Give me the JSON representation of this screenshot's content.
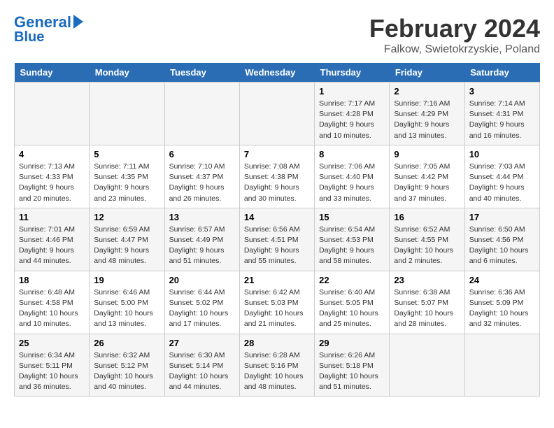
{
  "header": {
    "logo_line1": "General",
    "logo_line2": "Blue",
    "title": "February 2024",
    "subtitle": "Falkow, Swietokrzyskie, Poland"
  },
  "weekdays": [
    "Sunday",
    "Monday",
    "Tuesday",
    "Wednesday",
    "Thursday",
    "Friday",
    "Saturday"
  ],
  "weeks": [
    [
      {
        "day": "",
        "info": ""
      },
      {
        "day": "",
        "info": ""
      },
      {
        "day": "",
        "info": ""
      },
      {
        "day": "",
        "info": ""
      },
      {
        "day": "1",
        "info": "Sunrise: 7:17 AM\nSunset: 4:28 PM\nDaylight: 9 hours\nand 10 minutes."
      },
      {
        "day": "2",
        "info": "Sunrise: 7:16 AM\nSunset: 4:29 PM\nDaylight: 9 hours\nand 13 minutes."
      },
      {
        "day": "3",
        "info": "Sunrise: 7:14 AM\nSunset: 4:31 PM\nDaylight: 9 hours\nand 16 minutes."
      }
    ],
    [
      {
        "day": "4",
        "info": "Sunrise: 7:13 AM\nSunset: 4:33 PM\nDaylight: 9 hours\nand 20 minutes."
      },
      {
        "day": "5",
        "info": "Sunrise: 7:11 AM\nSunset: 4:35 PM\nDaylight: 9 hours\nand 23 minutes."
      },
      {
        "day": "6",
        "info": "Sunrise: 7:10 AM\nSunset: 4:37 PM\nDaylight: 9 hours\nand 26 minutes."
      },
      {
        "day": "7",
        "info": "Sunrise: 7:08 AM\nSunset: 4:38 PM\nDaylight: 9 hours\nand 30 minutes."
      },
      {
        "day": "8",
        "info": "Sunrise: 7:06 AM\nSunset: 4:40 PM\nDaylight: 9 hours\nand 33 minutes."
      },
      {
        "day": "9",
        "info": "Sunrise: 7:05 AM\nSunset: 4:42 PM\nDaylight: 9 hours\nand 37 minutes."
      },
      {
        "day": "10",
        "info": "Sunrise: 7:03 AM\nSunset: 4:44 PM\nDaylight: 9 hours\nand 40 minutes."
      }
    ],
    [
      {
        "day": "11",
        "info": "Sunrise: 7:01 AM\nSunset: 4:46 PM\nDaylight: 9 hours\nand 44 minutes."
      },
      {
        "day": "12",
        "info": "Sunrise: 6:59 AM\nSunset: 4:47 PM\nDaylight: 9 hours\nand 48 minutes."
      },
      {
        "day": "13",
        "info": "Sunrise: 6:57 AM\nSunset: 4:49 PM\nDaylight: 9 hours\nand 51 minutes."
      },
      {
        "day": "14",
        "info": "Sunrise: 6:56 AM\nSunset: 4:51 PM\nDaylight: 9 hours\nand 55 minutes."
      },
      {
        "day": "15",
        "info": "Sunrise: 6:54 AM\nSunset: 4:53 PM\nDaylight: 9 hours\nand 58 minutes."
      },
      {
        "day": "16",
        "info": "Sunrise: 6:52 AM\nSunset: 4:55 PM\nDaylight: 10 hours\nand 2 minutes."
      },
      {
        "day": "17",
        "info": "Sunrise: 6:50 AM\nSunset: 4:56 PM\nDaylight: 10 hours\nand 6 minutes."
      }
    ],
    [
      {
        "day": "18",
        "info": "Sunrise: 6:48 AM\nSunset: 4:58 PM\nDaylight: 10 hours\nand 10 minutes."
      },
      {
        "day": "19",
        "info": "Sunrise: 6:46 AM\nSunset: 5:00 PM\nDaylight: 10 hours\nand 13 minutes."
      },
      {
        "day": "20",
        "info": "Sunrise: 6:44 AM\nSunset: 5:02 PM\nDaylight: 10 hours\nand 17 minutes."
      },
      {
        "day": "21",
        "info": "Sunrise: 6:42 AM\nSunset: 5:03 PM\nDaylight: 10 hours\nand 21 minutes."
      },
      {
        "day": "22",
        "info": "Sunrise: 6:40 AM\nSunset: 5:05 PM\nDaylight: 10 hours\nand 25 minutes."
      },
      {
        "day": "23",
        "info": "Sunrise: 6:38 AM\nSunset: 5:07 PM\nDaylight: 10 hours\nand 28 minutes."
      },
      {
        "day": "24",
        "info": "Sunrise: 6:36 AM\nSunset: 5:09 PM\nDaylight: 10 hours\nand 32 minutes."
      }
    ],
    [
      {
        "day": "25",
        "info": "Sunrise: 6:34 AM\nSunset: 5:11 PM\nDaylight: 10 hours\nand 36 minutes."
      },
      {
        "day": "26",
        "info": "Sunrise: 6:32 AM\nSunset: 5:12 PM\nDaylight: 10 hours\nand 40 minutes."
      },
      {
        "day": "27",
        "info": "Sunrise: 6:30 AM\nSunset: 5:14 PM\nDaylight: 10 hours\nand 44 minutes."
      },
      {
        "day": "28",
        "info": "Sunrise: 6:28 AM\nSunset: 5:16 PM\nDaylight: 10 hours\nand 48 minutes."
      },
      {
        "day": "29",
        "info": "Sunrise: 6:26 AM\nSunset: 5:18 PM\nDaylight: 10 hours\nand 51 minutes."
      },
      {
        "day": "",
        "info": ""
      },
      {
        "day": "",
        "info": ""
      }
    ]
  ]
}
